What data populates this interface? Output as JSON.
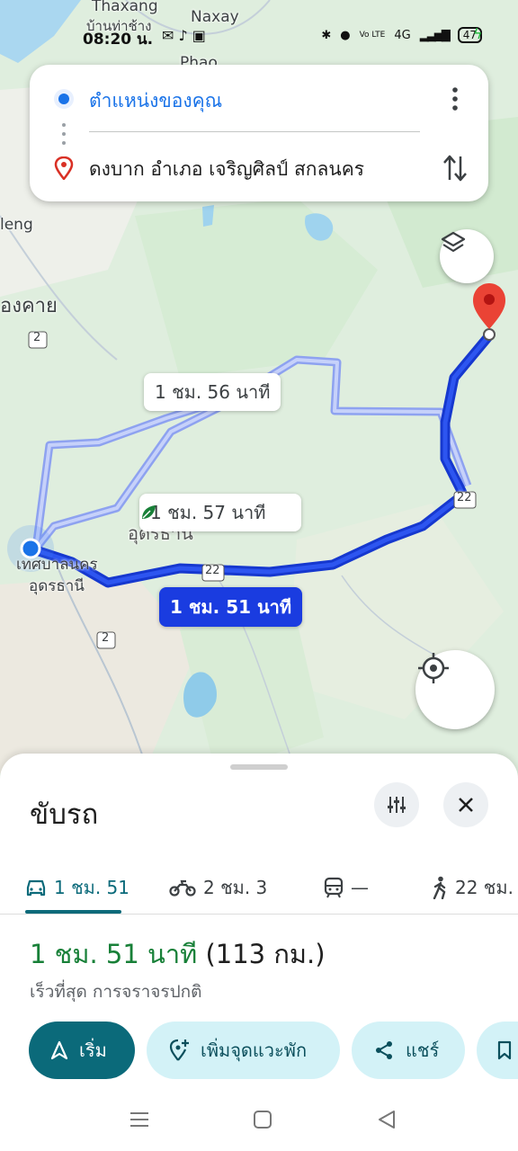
{
  "status_bar": {
    "time": "08:20 น.",
    "network": "4G",
    "volte": "Vo LTE",
    "battery": "47"
  },
  "search": {
    "origin": "ตำแหน่งของคุณ",
    "destination": "ดงบาก อำเภอ เจริญศิลป์ สกลนคร"
  },
  "map": {
    "labels": {
      "thaxang": "Thaxang",
      "naxay": "Naxay",
      "phao": "Phao",
      "thai_top": "บ้านท่าช้าง",
      "leng": "leng",
      "nongkhai": "องคาย",
      "city1": "เทศบาลนคร",
      "city2": "อุดรธานี",
      "area": "อุดรธานี",
      "road2a": "2",
      "road2b": "2",
      "road22a": "22",
      "road22b": "22"
    },
    "routes": [
      {
        "label": "1 ชม. 56 นาที",
        "active": false,
        "eco": false
      },
      {
        "label": "1 ชม. 57 นาที",
        "active": false,
        "eco": true
      },
      {
        "label": "1 ชม. 51 นาที",
        "active": true,
        "eco": false
      }
    ]
  },
  "sheet": {
    "title": "ขับรถ",
    "modes": [
      {
        "icon": "car-icon",
        "label": "1 ชม. 51"
      },
      {
        "icon": "motorcycle-icon",
        "label": "2 ชม. 3"
      },
      {
        "icon": "train-icon",
        "label": "—"
      },
      {
        "icon": "walk-icon",
        "label": "22 ชม."
      }
    ],
    "summary": {
      "duration": "1 ชม. 51 นาที",
      "distance": "(113 กม.)",
      "note": "เร็วที่สุด การจราจรปกติ"
    },
    "actions": {
      "start": "เริ่ม",
      "add_stop": "เพิ่มจุดแวะพัก",
      "share": "แชร์"
    }
  },
  "colors": {
    "route_active": "#1a3ce0",
    "route_alt": "#8ea2f0",
    "accent": "#0b6a7a",
    "duration_green": "#188038"
  }
}
